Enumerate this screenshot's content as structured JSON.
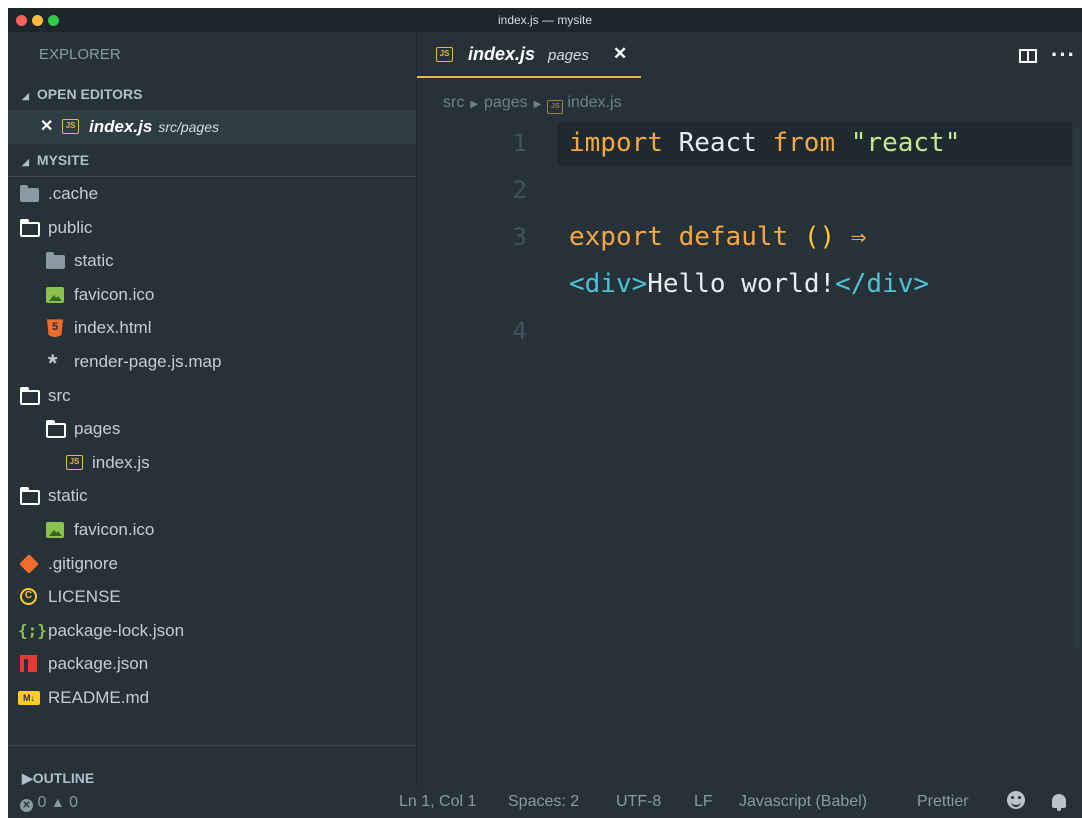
{
  "window": {
    "title": "index.js — mysite"
  },
  "sidebar": {
    "header": "EXPLORER",
    "open_editors_title": "OPEN EDITORS",
    "open_editor": {
      "name": "index.js",
      "path": "src/pages",
      "icon": "js-icon"
    },
    "project_title": "MYSITE",
    "tree": [
      {
        "label": ".cache",
        "icon": "folder-closed-icon"
      },
      {
        "label": "public",
        "icon": "folder-open-icon"
      },
      {
        "label": "static",
        "icon": "folder-closed-icon"
      },
      {
        "label": "favicon.ico",
        "icon": "image-icon"
      },
      {
        "label": "index.html",
        "icon": "html5-icon"
      },
      {
        "label": "render-page.js.map",
        "icon": "asterisk-icon"
      },
      {
        "label": "src",
        "icon": "folder-open-icon"
      },
      {
        "label": "pages",
        "icon": "folder-open-icon"
      },
      {
        "label": "index.js",
        "icon": "js-icon"
      },
      {
        "label": "static",
        "icon": "folder-open-icon"
      },
      {
        "label": "favicon.ico",
        "icon": "image-icon"
      },
      {
        "label": ".gitignore",
        "icon": "git-icon"
      },
      {
        "label": "LICENSE",
        "icon": "license-icon"
      },
      {
        "label": "package-lock.json",
        "icon": "json-icon"
      },
      {
        "label": "package.json",
        "icon": "npm-icon"
      },
      {
        "label": "README.md",
        "icon": "markdown-icon"
      }
    ],
    "outline_title": "OUTLINE"
  },
  "tabs": [
    {
      "name": "index.js",
      "dir": "pages",
      "close": "✕",
      "icon": "js-icon"
    }
  ],
  "breadcrumb": {
    "parts": [
      "src",
      "pages",
      "index.js"
    ]
  },
  "editor": {
    "lines": [
      {
        "number": "1",
        "text": "import React from \"react\""
      },
      {
        "number": "2",
        "text": ""
      },
      {
        "number": "3",
        "text": "export default () ⇒"
      },
      {
        "number": "",
        "text": "<div>Hello world!</div>"
      },
      {
        "number": "4",
        "text": ""
      }
    ]
  },
  "statusbar": {
    "errors": "0",
    "warnings": "0",
    "position": "Ln 1, Col 1",
    "spaces": "Spaces: 2",
    "encoding": "UTF-8",
    "eol": "LF",
    "language": "Javascript (Babel)",
    "formatter": "Prettier"
  },
  "colors": {
    "background": "#263238",
    "keyword": "#f7a743",
    "string": "#c3e88d",
    "tag": "#4cc2d8",
    "accent": "#e8b649"
  }
}
